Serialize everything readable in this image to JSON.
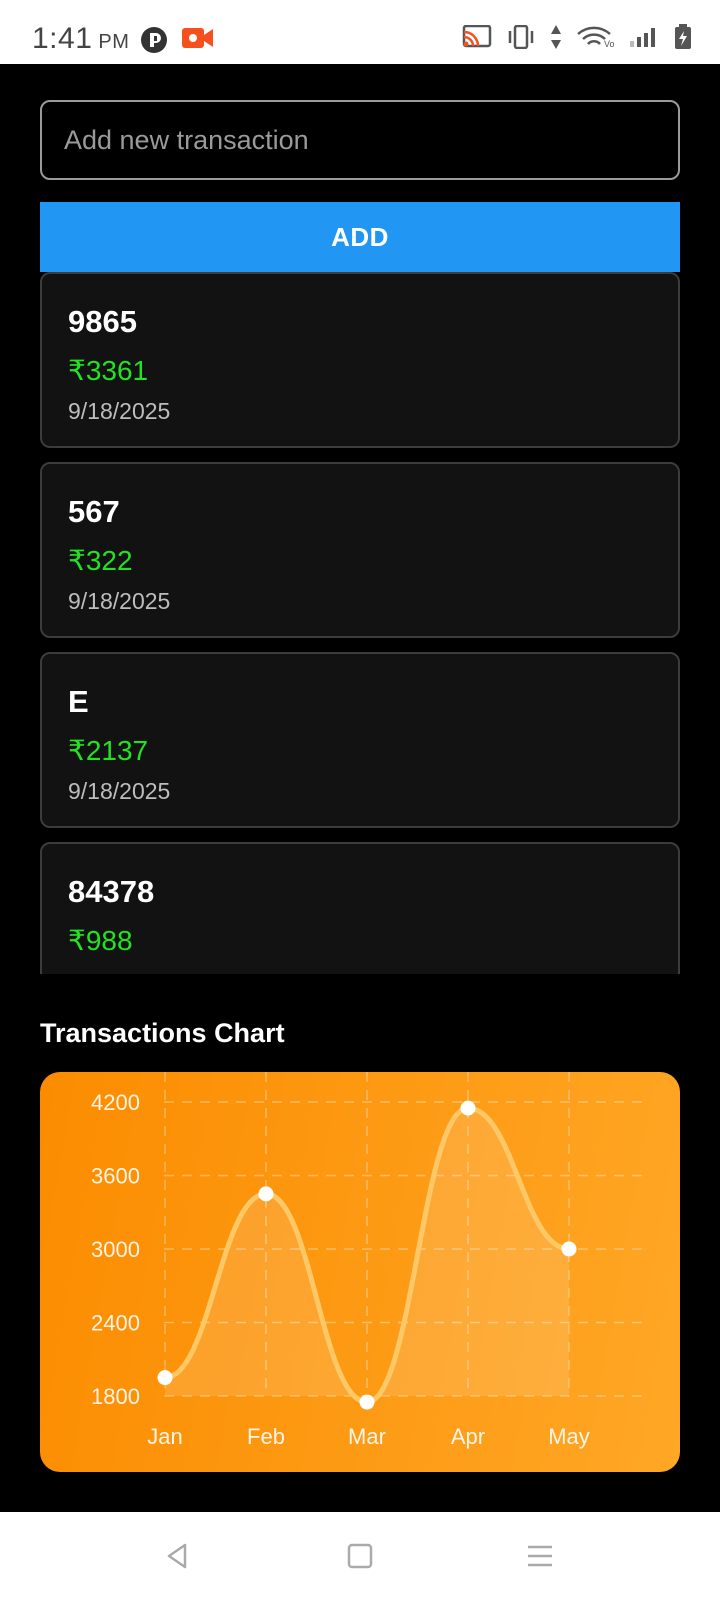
{
  "status_bar": {
    "time": "1:41",
    "ampm": "PM",
    "icons": [
      "p-app-icon",
      "screen-record-icon",
      "cast-icon",
      "vibrate-icon",
      "data-arrows-icon",
      "wifi-icon",
      "signal-icon",
      "battery-icon"
    ],
    "network_label": "Vo LTE"
  },
  "form": {
    "placeholder": "Add new transaction",
    "value": "",
    "add_label": "ADD"
  },
  "transactions": [
    {
      "name": "9865",
      "amount": "₹3361",
      "date": "9/18/2025"
    },
    {
      "name": "567",
      "amount": "₹322",
      "date": "9/18/2025"
    },
    {
      "name": "E",
      "amount": "₹2137",
      "date": "9/18/2025"
    },
    {
      "name": "84378",
      "amount": "₹988",
      "date": ""
    }
  ],
  "chart": {
    "title": "Transactions Chart"
  },
  "chart_data": {
    "type": "area",
    "title": "Transactions Chart",
    "categories": [
      "Jan",
      "Feb",
      "Mar",
      "Apr",
      "May"
    ],
    "values": [
      1950,
      3450,
      1750,
      4150,
      3000
    ],
    "y_ticks": [
      1800,
      2400,
      3000,
      3600,
      4200
    ],
    "ylim": [
      1800,
      4200
    ],
    "grid": true,
    "colors": {
      "bg_start": "#fb8c00",
      "bg_end": "#ffa726",
      "line": "#ffc866",
      "point": "#ffffff"
    }
  },
  "nav_bar": {
    "icons": [
      "back-icon",
      "home-icon",
      "recents-menu-icon"
    ]
  }
}
